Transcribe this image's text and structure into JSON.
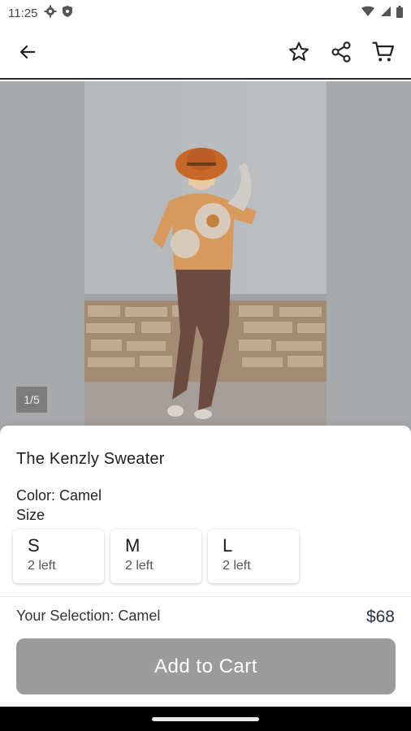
{
  "status_bar": {
    "time": "11:25",
    "icons": [
      "gear-icon",
      "shield-icon"
    ],
    "right_icons": [
      "wifi-icon",
      "signal-icon",
      "battery-icon"
    ]
  },
  "app_bar": {
    "back_icon": "arrow-left-icon",
    "actions": [
      "star-icon",
      "share-icon",
      "cart-icon"
    ]
  },
  "gallery": {
    "counter": "1/5"
  },
  "product": {
    "title": "The Kenzly Sweater",
    "color_label": "Color: Camel",
    "size_label": "Size",
    "sizes": [
      {
        "size": "S",
        "stock": "2 left"
      },
      {
        "size": "M",
        "stock": "2 left"
      },
      {
        "size": "L",
        "stock": "2 left"
      }
    ],
    "selection": "Your Selection: Camel",
    "price": "$68",
    "add_to_cart": "Add to Cart"
  },
  "colors": {
    "button_disabled": "#9b9b9b",
    "price_text": "#2a3344",
    "sweater": "#d89a5c",
    "hat": "#c7672a",
    "pants": "#6b4a3f"
  }
}
